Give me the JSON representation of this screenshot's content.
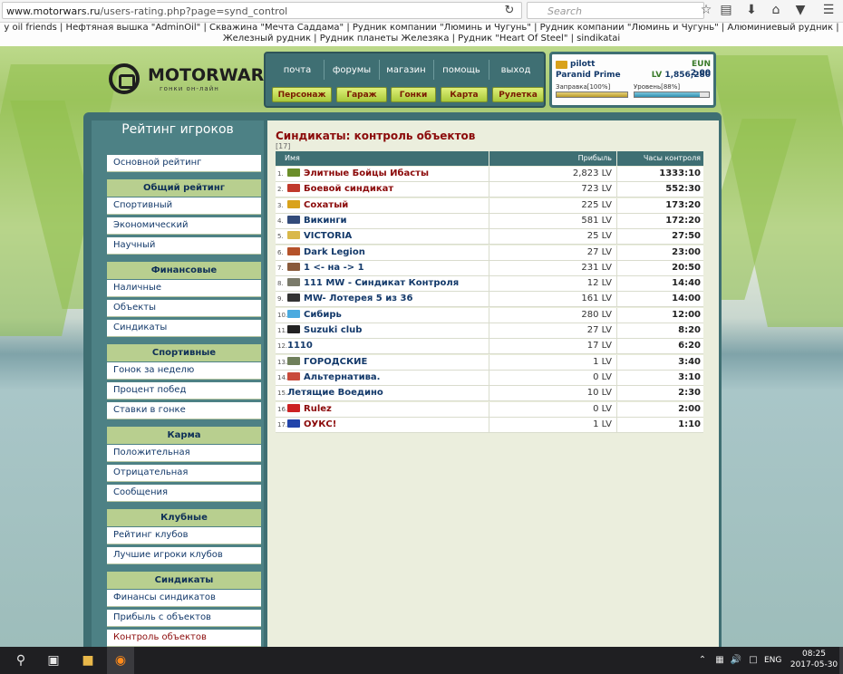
{
  "browser": {
    "url_host": "www.motorwars.ru",
    "url_path": "/users-rating.php?page=synd_control",
    "search_placeholder": "Search",
    "icons": [
      "reload-icon",
      "star-icon",
      "reading-list-icon",
      "download-icon",
      "home-icon",
      "pocket-icon",
      "menu-icon"
    ]
  },
  "bookmarks_text": "y oil friends | Нефтяная вышка \"AdminOil\" | Скважина \"Мечта Саддама\" | Рудник компании \"Люминь и Чугунь\" | Рудник компании \"Люминь и Чугунь\" | Алюминиевый рудник | Железный рудник | Рудник планеты Железяка | Рудник \"Heart Of Steel\" | sindikatai",
  "logo": {
    "title": "MOTORWARS.RU",
    "subtitle": "гонки он-лайн"
  },
  "nav": {
    "links": [
      "почта",
      "форумы",
      "магазин",
      "помощь",
      "выход"
    ],
    "buttons": [
      "Персонаж",
      "Гараж",
      "Гонки",
      "Карта",
      "Рулетка"
    ]
  },
  "user": {
    "name": "pilott",
    "car": "Paranid Prime",
    "eun_label": "EUN",
    "eun_value": "2.00",
    "lv_label": "LV",
    "lv_value": "1,856,280",
    "fuel_label": "Заправка[100%]",
    "fuel_percent": 100,
    "level_label": "Уровень[88%]",
    "level_percent": 88
  },
  "sidebar": {
    "title": "Рейтинг игроков",
    "items": [
      {
        "type": "link",
        "label": "Основной рейтинг"
      },
      {
        "type": "head",
        "label": "Общий рейтинг"
      },
      {
        "type": "link",
        "label": "Спортивный"
      },
      {
        "type": "link",
        "label": "Экономический"
      },
      {
        "type": "link",
        "label": "Научный"
      },
      {
        "type": "head",
        "label": "Финансовые"
      },
      {
        "type": "link",
        "label": "Наличные"
      },
      {
        "type": "link",
        "label": "Объекты"
      },
      {
        "type": "link",
        "label": "Синдикаты"
      },
      {
        "type": "head",
        "label": "Спортивные"
      },
      {
        "type": "link",
        "label": "Гонок за неделю"
      },
      {
        "type": "link",
        "label": "Процент побед"
      },
      {
        "type": "link",
        "label": "Ставки в гонке"
      },
      {
        "type": "head",
        "label": "Карма"
      },
      {
        "type": "link",
        "label": "Положительная"
      },
      {
        "type": "link",
        "label": "Отрицательная"
      },
      {
        "type": "link",
        "label": "Сообщения"
      },
      {
        "type": "head",
        "label": "Клубные"
      },
      {
        "type": "link",
        "label": "Рейтинг клубов"
      },
      {
        "type": "link",
        "label": "Лучшие игроки клубов"
      },
      {
        "type": "head",
        "label": "Синдикаты"
      },
      {
        "type": "link",
        "label": "Финансы синдикатов"
      },
      {
        "type": "link",
        "label": "Прибыль с объектов"
      },
      {
        "type": "link",
        "label": "Контроль объектов",
        "active": true
      }
    ]
  },
  "content": {
    "title": "Синдикаты: контроль объектов",
    "count": "[17]",
    "columns": [
      "Имя",
      "Прибыль",
      "Часы контроля"
    ],
    "rows": [
      {
        "rank": "1.",
        "name": "Элитные Бойцы Ибасты",
        "profit": "2,823 LV",
        "hours": "1333:10",
        "color": "#8b0a0a",
        "icon": "#6b8e2a"
      },
      {
        "rank": "2.",
        "name": "Боевой синдикат",
        "profit": "723 LV",
        "hours": "552:30",
        "color": "#8b0a0a",
        "icon": "#c0392b"
      },
      {
        "rank": "3.",
        "name": "Сохатый",
        "profit": "225 LV",
        "hours": "173:20",
        "color": "#8b0a0a",
        "icon": "#d9a21b"
      },
      {
        "rank": "4.",
        "name": "Викинги",
        "profit": "581 LV",
        "hours": "172:20",
        "color": "#13396a",
        "icon": "#334b7a"
      },
      {
        "rank": "5.",
        "name": "VICTORIA",
        "profit": "25 LV",
        "hours": "27:50",
        "color": "#13396a",
        "icon": "#d9b84a"
      },
      {
        "rank": "6.",
        "name": "Dark Legion",
        "profit": "27 LV",
        "hours": "23:00",
        "color": "#13396a",
        "icon": "#b5522a"
      },
      {
        "rank": "7.",
        "name": "1 <- на -> 1",
        "profit": "231 LV",
        "hours": "20:50",
        "color": "#13396a",
        "icon": "#8a5a3a"
      },
      {
        "rank": "8.",
        "name": "111 MW - Синдикат Контроля",
        "profit": "12 LV",
        "hours": "14:40",
        "color": "#13396a",
        "icon": "#7a7a6a"
      },
      {
        "rank": "9.",
        "name": "MW- Лотерея 5 из 36",
        "profit": "161 LV",
        "hours": "14:00",
        "color": "#13396a",
        "icon": "#333333"
      },
      {
        "rank": "10.",
        "name": "Сибирь",
        "profit": "280 LV",
        "hours": "12:00",
        "color": "#13396a",
        "icon": "#4aaadf"
      },
      {
        "rank": "11.",
        "name": "Suzuki club",
        "profit": "27 LV",
        "hours": "8:20",
        "color": "#13396a",
        "icon": "#222222"
      },
      {
        "rank": "12.",
        "name": "1110",
        "profit": "17 LV",
        "hours": "6:20",
        "color": "#13396a",
        "icon": ""
      },
      {
        "rank": "13.",
        "name": "ГОРОДСКИЕ",
        "profit": "1 LV",
        "hours": "3:40",
        "color": "#13396a",
        "icon": "#6f7f5a"
      },
      {
        "rank": "14.",
        "name": "Альтернатива.",
        "profit": "0 LV",
        "hours": "3:10",
        "color": "#13396a",
        "icon": "#c94a3a"
      },
      {
        "rank": "15.",
        "name": "Летящие Воедино",
        "profit": "10 LV",
        "hours": "2:30",
        "color": "#13396a",
        "icon": ""
      },
      {
        "rank": "16.",
        "name": "Rulez",
        "profit": "0 LV",
        "hours": "2:00",
        "color": "#8b0a0a",
        "icon": "#cc2222"
      },
      {
        "rank": "17.",
        "name": "ОУКС!",
        "profit": "1 LV",
        "hours": "1:10",
        "color": "#8b0a0a",
        "icon": "#2244aa"
      }
    ]
  },
  "taskbar": {
    "lang": "ENG",
    "time": "08:25",
    "date": "2017-05-30"
  }
}
